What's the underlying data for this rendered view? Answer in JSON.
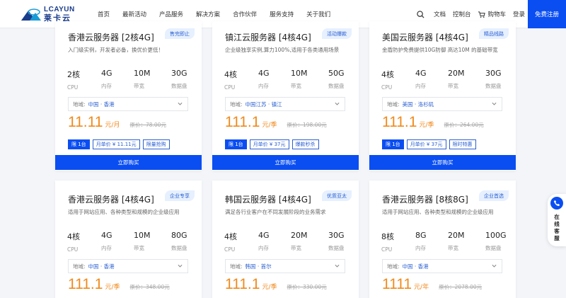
{
  "brand": {
    "logo_en": "LCAYUN",
    "logo_cn": "莱卡云"
  },
  "nav": [
    {
      "name": "nav-home",
      "label": "首页"
    },
    {
      "name": "nav-promotions",
      "label": "最新活动"
    },
    {
      "name": "nav-products",
      "label": "产品服务"
    },
    {
      "name": "nav-solutions",
      "label": "解决方案"
    },
    {
      "name": "nav-partners",
      "label": "合作伙伴"
    },
    {
      "name": "nav-support",
      "label": "服务支持"
    },
    {
      "name": "nav-about",
      "label": "关于我们"
    }
  ],
  "tools": {
    "docs": "文档",
    "console": "控制台",
    "cart": "购物车",
    "login": "登录",
    "register": "免费注册"
  },
  "spec_labels": [
    "CPU",
    "内存",
    "带宽",
    "数据盘"
  ],
  "region_label": "地域:",
  "buy_label": "立即购买",
  "cards": [
    {
      "title": "香港云服务器 [2核4G]",
      "tag": "售完即止",
      "desc": "入门级实例，开发者必备，换优价更低！",
      "specs": [
        "2核",
        "4G",
        "10M",
        "30G"
      ],
      "region": "中国 · 香港",
      "price": "11.11",
      "unit": "元/月",
      "original": "原价：78.00元",
      "badges": [
        "限 1台",
        "月单价 ¥ 11.11元",
        "限量抢购"
      ]
    },
    {
      "title": "镇江云服务器 [4核4G]",
      "tag": "活动爆款",
      "desc": "企业级独享实例,算力100%,适用于各类通用场景",
      "specs": [
        "4核",
        "4G",
        "10M",
        "50G"
      ],
      "region": "中国江苏 · 镇江",
      "price": "111.1",
      "unit": "元/季",
      "original": "原价：198.00元",
      "badges": [
        "限 1台",
        "月单价 ¥ 37元",
        "爆款秒杀"
      ]
    },
    {
      "title": "美国云服务器 [4核4G]",
      "tag": "精品线路",
      "desc": "金盾防护免费提供10G防御 高达10M 的基础带宽",
      "specs": [
        "4核",
        "4G",
        "20M",
        "30G"
      ],
      "region": "美国 · 洛杉矶",
      "price": "111.1",
      "unit": "元/季",
      "original": "原价：264.00元",
      "badges": [
        "限 1台",
        "月单价 ¥ 37元",
        "限时特惠"
      ]
    },
    {
      "title": "香港云服务器 [4核4G]",
      "tag": "企业专享",
      "desc": "适用于网站应用、各种类型和规模的企业级应用",
      "specs": [
        "4核",
        "4G",
        "10M",
        "80G"
      ],
      "region": "中国 · 香港",
      "price": "111.1",
      "unit": "元/季",
      "original": "原价：348.00元",
      "badges": []
    },
    {
      "title": "韩国云服务器 [4核4G]",
      "tag": "优质亚太",
      "desc": "满足各行业客户在不同发展阶段的业务需求",
      "specs": [
        "4核",
        "4G",
        "20M",
        "30G"
      ],
      "region": "韩国 · 首尔",
      "price": "111.1",
      "unit": "元/季",
      "original": "原价：330.00元",
      "badges": []
    },
    {
      "title": "香港云服务器 [8核8G]",
      "tag": "企业首选",
      "desc": "适用于网站应用、各种类型和规模的企业级应用",
      "specs": [
        "8核",
        "8G",
        "20M",
        "100G"
      ],
      "region": "中国 · 香港",
      "price": "1111",
      "unit": "元/年",
      "original": "原价：2078.00元",
      "badges": []
    }
  ],
  "float_service": "在线客服",
  "colors": {
    "primary": "#0a4ef2",
    "price": "#f08a1c",
    "link": "#2a5fd1"
  }
}
